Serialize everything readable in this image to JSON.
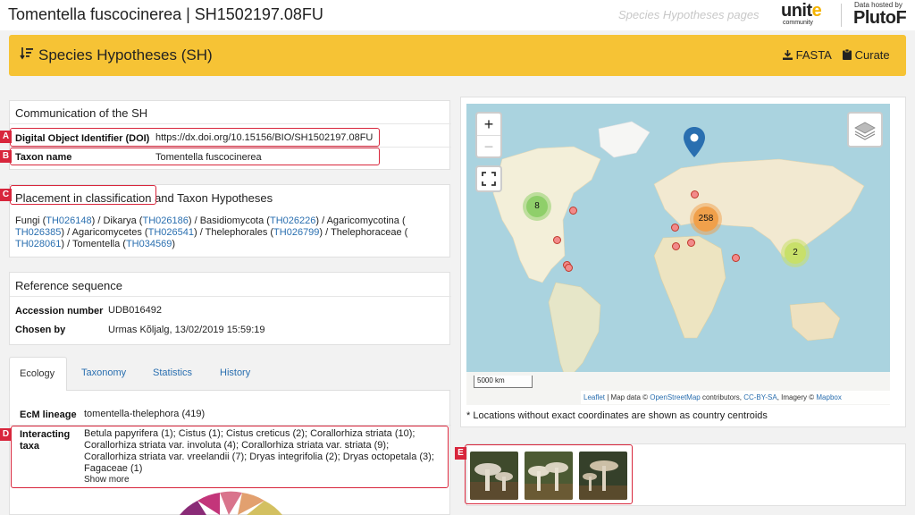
{
  "header": {
    "title": "Tomentella fuscocinerea | SH1502197.08FU",
    "sh_pages": "Species Hypotheses pages",
    "unite_word_a": "unit",
    "unite_word_b": "e",
    "unite_sub": "community",
    "hosted_by": "Data hosted by",
    "plutof": "PlutoF"
  },
  "toolbar": {
    "title": "Species Hypotheses (SH)",
    "fasta_label": "FASTA",
    "curate_label": "Curate"
  },
  "communication": {
    "title": "Communication of the SH",
    "doi_label": "Digital Object Identifier (DOI)",
    "doi_value": "https://dx.doi.org/10.15156/BIO/SH1502197.08FU",
    "taxon_label": "Taxon name",
    "taxon_value": "Tomentella fuscocinerea"
  },
  "placement": {
    "title_a": "Placement in classification",
    "title_b": " and Taxon Hypotheses",
    "items": [
      {
        "name": "Fungi (",
        "th": "TH026148",
        "sep": ") / "
      },
      {
        "name": "Dikarya (",
        "th": "TH026186",
        "sep": ") / "
      },
      {
        "name": "Basidiomycota  (",
        "th": "TH026226",
        "sep": ") / "
      },
      {
        "name": "Agaricomycotina (",
        "th": "TH026385",
        "sep": ") / "
      },
      {
        "name": "Agaricomycetes  (",
        "th": "TH026541",
        "sep": ") / "
      },
      {
        "name": "Thelephorales  (",
        "th": "TH026799",
        "sep": ") / "
      },
      {
        "name": "Thelephoraceae (",
        "th": "TH028061",
        "sep": ") / "
      },
      {
        "name": "Tomentella  (",
        "th": "TH034569",
        "sep": ")"
      }
    ]
  },
  "reference": {
    "title": "Reference sequence",
    "accession_label": "Accession number",
    "accession_value": "UDB016492",
    "chosen_label": "Chosen by",
    "chosen_value": "Urmas Kõljalg, 13/02/2019 15:59:19"
  },
  "tabs": [
    {
      "label": "Ecology"
    },
    {
      "label": "Taxonomy"
    },
    {
      "label": "Statistics"
    },
    {
      "label": "History"
    }
  ],
  "ecology": {
    "ecm_label": "EcM lineage",
    "ecm_value": "tomentella-thelephora (419)",
    "interacting_label_1": "Interacting",
    "interacting_label_2": "taxa",
    "interacting_lines": [
      "Betula papyrifera (1); Cistus (1); Cistus creticus (2); Corallorhiza striata (10);",
      "Corallorhiza striata var. involuta (4); Corallorhiza striata var. striata (9);",
      "Corallorhiza striata var. vreelandii (7); Dryas integrifolia (2); Dryas octopetala (3);",
      "Fagaceae (1)"
    ],
    "show_more": "Show more"
  },
  "map": {
    "zoom_in": "+",
    "zoom_out": "−",
    "clusters": [
      "8",
      "258",
      "2"
    ],
    "scale": "5000 km",
    "attr_leaflet": "Leaflet",
    "attr_text_1": " | Map data © ",
    "attr_osm": "OpenStreetMap",
    "attr_text_2": " contributors, ",
    "attr_license": "CC-BY-SA",
    "attr_text_3": ", Imagery © ",
    "attr_mapbox": "Mapbox",
    "footnote": "* Locations without exact coordinates are shown as country centroids"
  },
  "badges": [
    "A",
    "B",
    "C",
    "D",
    "E"
  ],
  "colors": {
    "accent_yellow": "#f6c335",
    "link_blue": "#2a6fb0",
    "annotation_red": "#d8263c",
    "cluster_green": "#8fcf6a",
    "cluster_orange": "#f0a04b",
    "cluster_yellow": "#c8e06a"
  }
}
